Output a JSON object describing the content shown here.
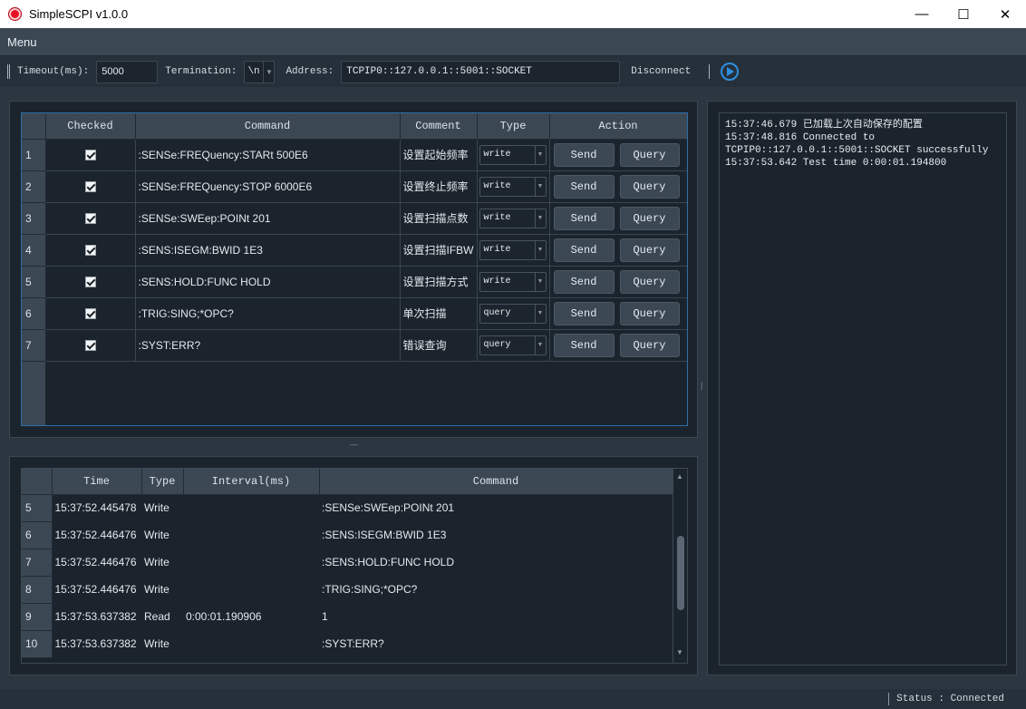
{
  "window": {
    "title": "SimpleSCPI v1.0.0",
    "minimize": "—",
    "maximize": "☐",
    "close": "✕"
  },
  "menu": {
    "label": "Menu"
  },
  "toolbar": {
    "timeout_label": "Timeout(ms):",
    "timeout_value": "5000",
    "termination_label": "Termination:",
    "termination_value": "\\n",
    "address_label": "Address:",
    "address_value": "TCPIP0::127.0.0.1::5001::SOCKET",
    "disconnect_label": "Disconnect"
  },
  "commands": {
    "headers": [
      "Checked",
      "Command",
      "Comment",
      "Type",
      "Action"
    ],
    "send_label": "Send",
    "query_label": "Query",
    "rows": [
      {
        "idx": "1",
        "command": ":SENSe:FREQuency:STARt 500E6",
        "comment": "设置起始频率",
        "type": "write"
      },
      {
        "idx": "2",
        "command": ":SENSe:FREQuency:STOP 6000E6",
        "comment": "设置终止频率",
        "type": "write"
      },
      {
        "idx": "3",
        "command": ":SENSe:SWEep:POINt 201",
        "comment": "设置扫描点数",
        "type": "write"
      },
      {
        "idx": "4",
        "command": ":SENS:ISEGM:BWID 1E3",
        "comment": "设置扫描IFBW",
        "type": "write"
      },
      {
        "idx": "5",
        "command": ":SENS:HOLD:FUNC HOLD",
        "comment": "设置扫描方式",
        "type": "write"
      },
      {
        "idx": "6",
        "command": ":TRIG:SING;*OPC?",
        "comment": "单次扫描",
        "type": "query"
      },
      {
        "idx": "7",
        "command": ":SYST:ERR?",
        "comment": "错误查询",
        "type": "query"
      }
    ]
  },
  "history": {
    "headers": [
      "Time",
      "Type",
      "Interval(ms)",
      "Command"
    ],
    "rows": [
      {
        "idx": "5",
        "time": "15:37:52.445478",
        "type": "Write",
        "interval": "",
        "command": ":SENSe:SWEep:POINt 201"
      },
      {
        "idx": "6",
        "time": "15:37:52.446476",
        "type": "Write",
        "interval": "",
        "command": ":SENS:ISEGM:BWID 1E3"
      },
      {
        "idx": "7",
        "time": "15:37:52.446476",
        "type": "Write",
        "interval": "",
        "command": ":SENS:HOLD:FUNC HOLD"
      },
      {
        "idx": "8",
        "time": "15:37:52.446476",
        "type": "Write",
        "interval": "",
        "command": ":TRIG:SING;*OPC?"
      },
      {
        "idx": "9",
        "time": "15:37:53.637382",
        "type": "Read",
        "interval": "0:00:01.190906",
        "command": "1"
      },
      {
        "idx": "10",
        "time": "15:37:53.637382",
        "type": "Write",
        "interval": "",
        "command": ":SYST:ERR?"
      }
    ]
  },
  "log": {
    "lines": [
      "15:37:46.679 已加载上次自动保存的配置",
      "15:37:48.816 Connected to",
      "TCPIP0::127.0.0.1::5001::SOCKET successfully",
      "15:37:53.642 Test time 0:00:01.194800"
    ]
  },
  "status": {
    "text": "Status : Connected"
  }
}
